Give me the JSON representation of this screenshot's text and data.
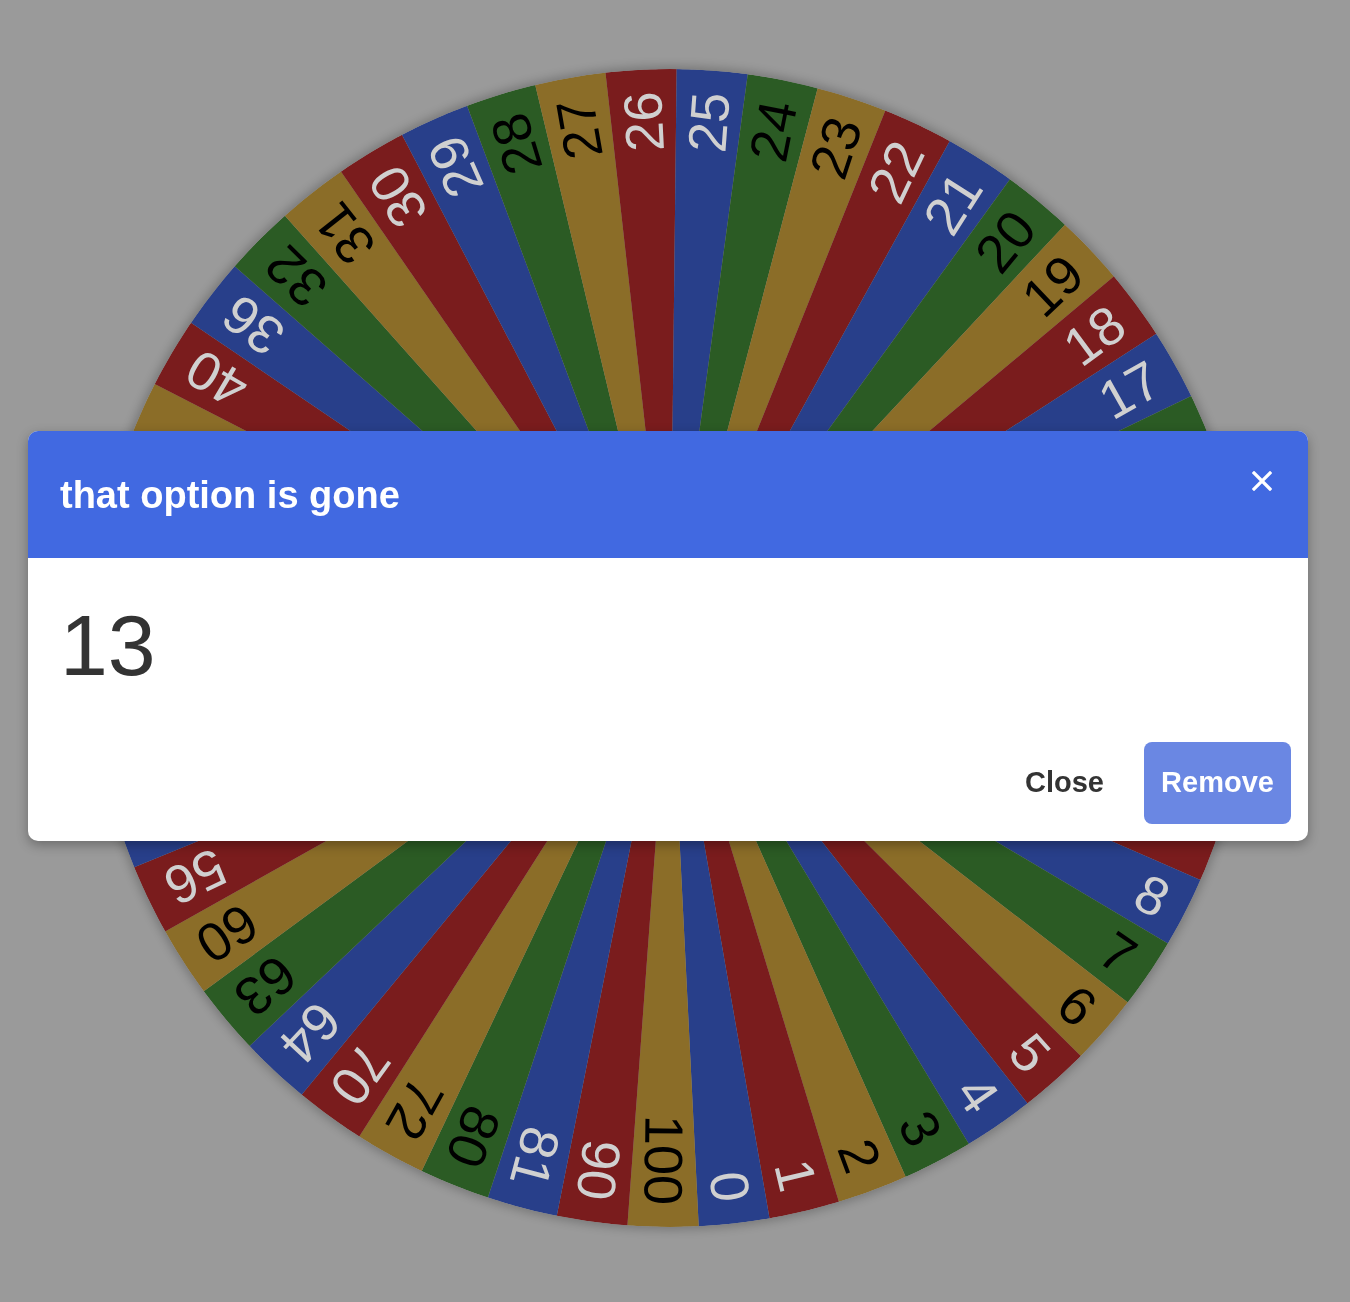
{
  "wheel": {
    "upper_arc": [
      {
        "color": "#8b6d28"
      },
      {
        "label": "40",
        "color": "#7a1c1d"
      },
      {
        "label": "36",
        "color": "#283f8a"
      },
      {
        "label": "32",
        "color": "#2b5b24"
      },
      {
        "label": "31",
        "color": "#8b6d28"
      },
      {
        "label": "30",
        "color": "#7a1c1d"
      },
      {
        "label": "29",
        "color": "#283f8a"
      },
      {
        "label": "28",
        "color": "#2b5b24"
      },
      {
        "label": "27",
        "color": "#8b6d28"
      },
      {
        "label": "26",
        "color": "#7a1c1d"
      },
      {
        "label": "25",
        "color": "#283f8a"
      },
      {
        "label": "24",
        "color": "#2b5b24"
      },
      {
        "label": "23",
        "color": "#8b6d28"
      },
      {
        "label": "22",
        "color": "#7a1c1d"
      },
      {
        "label": "21",
        "color": "#283f8a"
      },
      {
        "label": "20",
        "color": "#2b5b24"
      },
      {
        "label": "19",
        "color": "#8b6d28"
      },
      {
        "label": "18",
        "color": "#7a1c1d"
      },
      {
        "label": "17",
        "color": "#283f8a"
      },
      {
        "color": "#2b5b24"
      }
    ],
    "lower_arc": [
      {
        "color": "#7a1c1d"
      },
      {
        "label": "8",
        "color": "#283f8a"
      },
      {
        "label": "7",
        "color": "#2b5b24"
      },
      {
        "label": "6",
        "color": "#8b6d28"
      },
      {
        "label": "5",
        "color": "#7a1c1d"
      },
      {
        "label": "4",
        "color": "#283f8a"
      },
      {
        "label": "3",
        "color": "#2b5b24"
      },
      {
        "label": "2",
        "color": "#8b6d28"
      },
      {
        "label": "1",
        "color": "#7a1c1d"
      },
      {
        "label": "0",
        "color": "#283f8a"
      },
      {
        "label": "100",
        "color": "#8b6d28"
      },
      {
        "label": "90",
        "color": "#7a1c1d"
      },
      {
        "label": "81",
        "color": "#283f8a"
      },
      {
        "label": "80",
        "color": "#2b5b24"
      },
      {
        "label": "72",
        "color": "#8b6d28"
      },
      {
        "label": "70",
        "color": "#7a1c1d"
      },
      {
        "label": "64",
        "color": "#283f8a"
      },
      {
        "label": "63",
        "color": "#2b5b24"
      },
      {
        "label": "60",
        "color": "#8b6d28"
      },
      {
        "label": "56",
        "color": "#7a1c1d"
      },
      {
        "color": "#283f8a"
      }
    ]
  },
  "dialog": {
    "title": "that option is gone",
    "value": "13",
    "buttons": [
      {
        "label": "Close",
        "kind": "text"
      },
      {
        "label": "Remove",
        "kind": "filled"
      }
    ]
  }
}
